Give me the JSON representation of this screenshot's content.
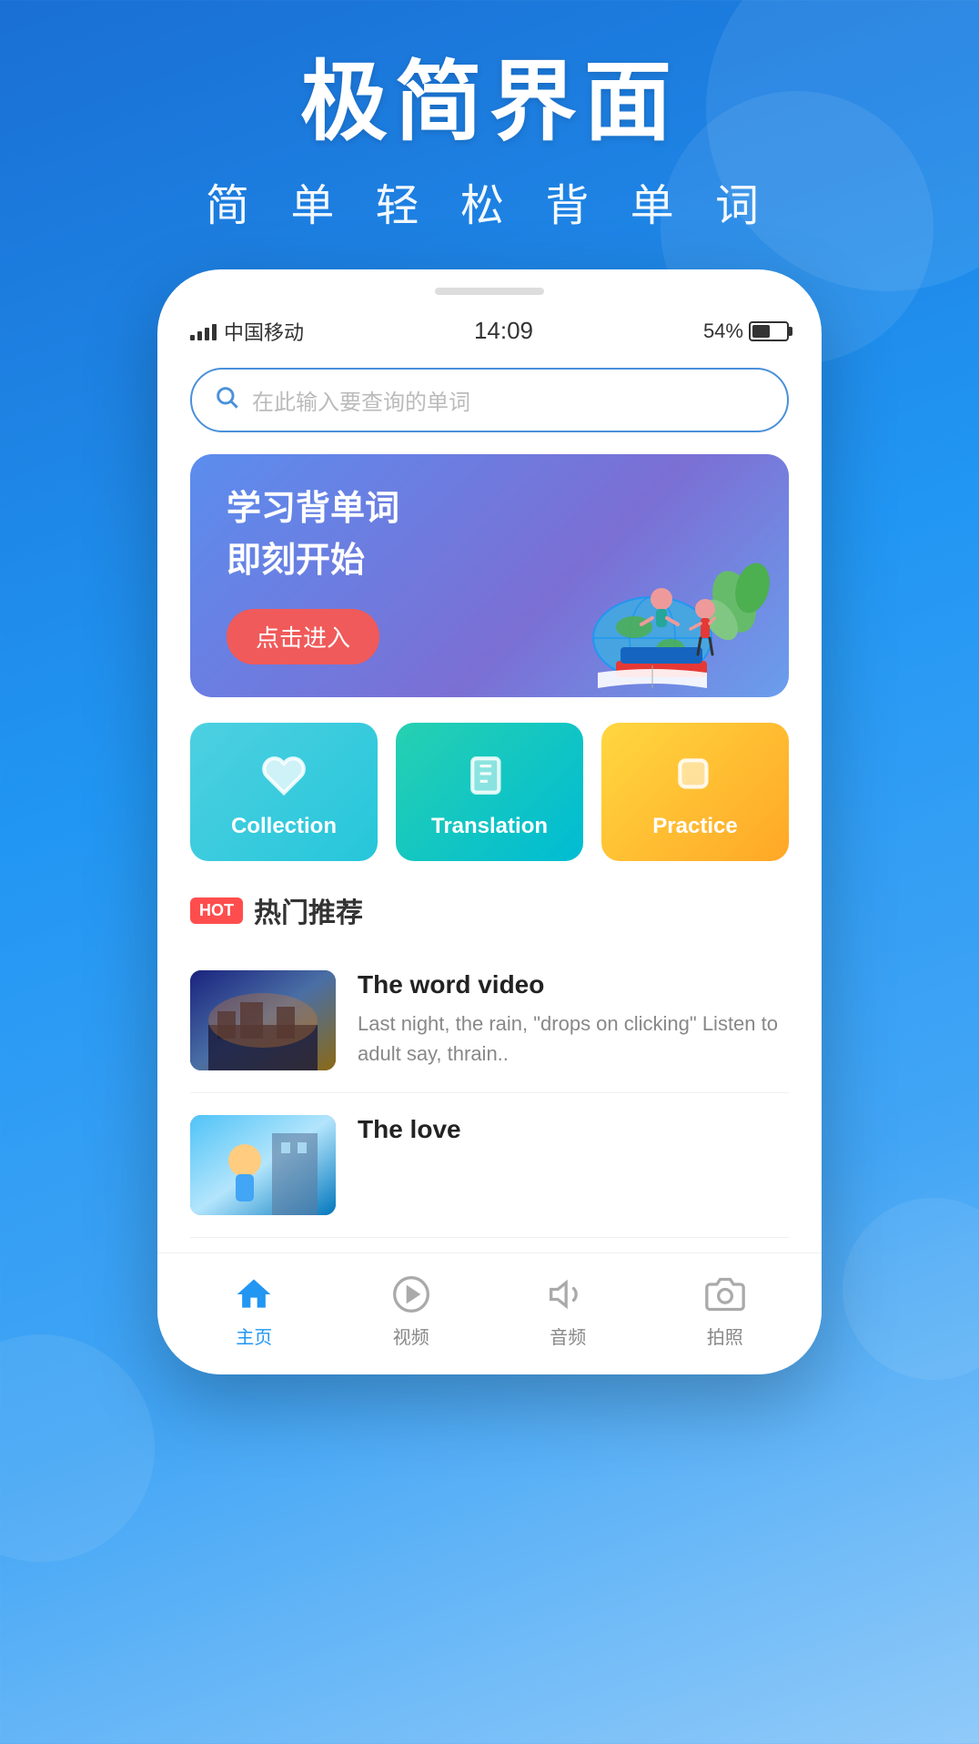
{
  "background": {
    "gradient_start": "#1a6fd4",
    "gradient_end": "#90caf9"
  },
  "hero": {
    "title": "极简界面",
    "subtitle": "简 单 轻 松 背 单 词"
  },
  "statusBar": {
    "carrier": "中国移动",
    "time": "14:09",
    "battery": "54%"
  },
  "search": {
    "placeholder": "在此输入要查询的单词"
  },
  "banner": {
    "line1": "学习背单词",
    "line2": "即刻开始",
    "button": "点击进入"
  },
  "actions": [
    {
      "id": "collection",
      "label": "Collection",
      "icon": "heart"
    },
    {
      "id": "translation",
      "label": "Translation",
      "icon": "book"
    },
    {
      "id": "practice",
      "label": "Practice",
      "icon": "square"
    }
  ],
  "hotSection": {
    "badge": "HOT",
    "title": "热门推荐"
  },
  "contentItems": [
    {
      "id": "item-1",
      "title": "The word video",
      "desc": "Last night, the rain, \"drops on clicking\" Listen to adult say, thrain.."
    },
    {
      "id": "item-2",
      "title": "The love",
      "desc": ""
    }
  ],
  "bottomNav": [
    {
      "id": "home",
      "label": "主页",
      "active": true
    },
    {
      "id": "play",
      "label": "视频",
      "active": false
    },
    {
      "id": "sound",
      "label": "音频",
      "active": false
    },
    {
      "id": "camera",
      "label": "拍照",
      "active": false
    }
  ]
}
